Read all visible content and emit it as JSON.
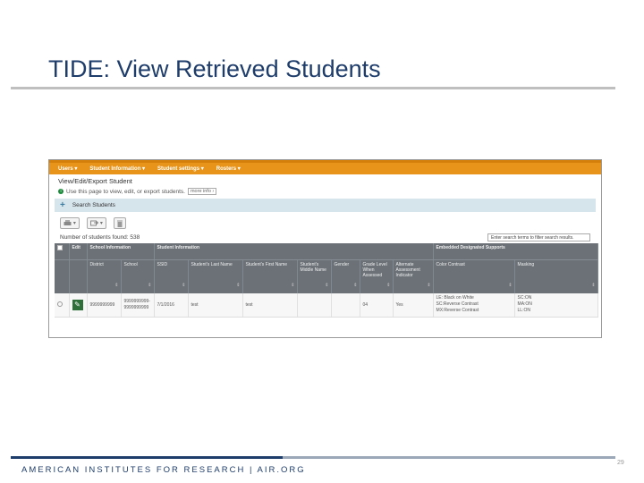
{
  "slide": {
    "title": "TIDE: View Retrieved Students",
    "footer": "AMERICAN INSTITUTES FOR RESEARCH | AIR.ORG",
    "page_number": "29"
  },
  "app": {
    "menu": [
      "Users ▾",
      "Student Information ▾",
      "Student settings ▾",
      "Rosters ▾"
    ],
    "panel_title": "View/Edit/Export Student",
    "info_text": "Use this page to view, edit, or export students.",
    "more_info": "more info ›",
    "search_label": "Search Students",
    "toolbar": {
      "print_icon": "print-icon",
      "export_icon": "export-icon",
      "delete_icon": "trash-icon"
    },
    "count_text": "Number of students found: 538",
    "filter_placeholder": "Enter search terms to filter search results.",
    "table": {
      "groups": [
        "Edit",
        "School Information",
        "Student Information",
        "Embedded Designated Supports"
      ],
      "columns": [
        "District",
        "School",
        "SSID",
        "Student's Last Name",
        "Student's First Name",
        "Student's Middle Name",
        "Gender",
        "Grade Level When Assessed",
        "Alternate Assessment Indicator",
        "Color Contrast",
        "Masking"
      ],
      "row": {
        "district": "9999999999",
        "school_1": "9999999999-",
        "school_2": "9999999999",
        "ssid": "7/1/2016",
        "last_name": "test",
        "first_name": "test",
        "middle_name": "",
        "gender": "",
        "grade": "04",
        "alternate": "Yes",
        "color_1": "LE: Black on White",
        "color_2": "SC:Reverse Contrast",
        "color_3": "MX:Reverse Contrast",
        "mask_1": "SC:ON",
        "mask_2": "MA:ON",
        "mask_3": "LL:ON"
      }
    }
  }
}
